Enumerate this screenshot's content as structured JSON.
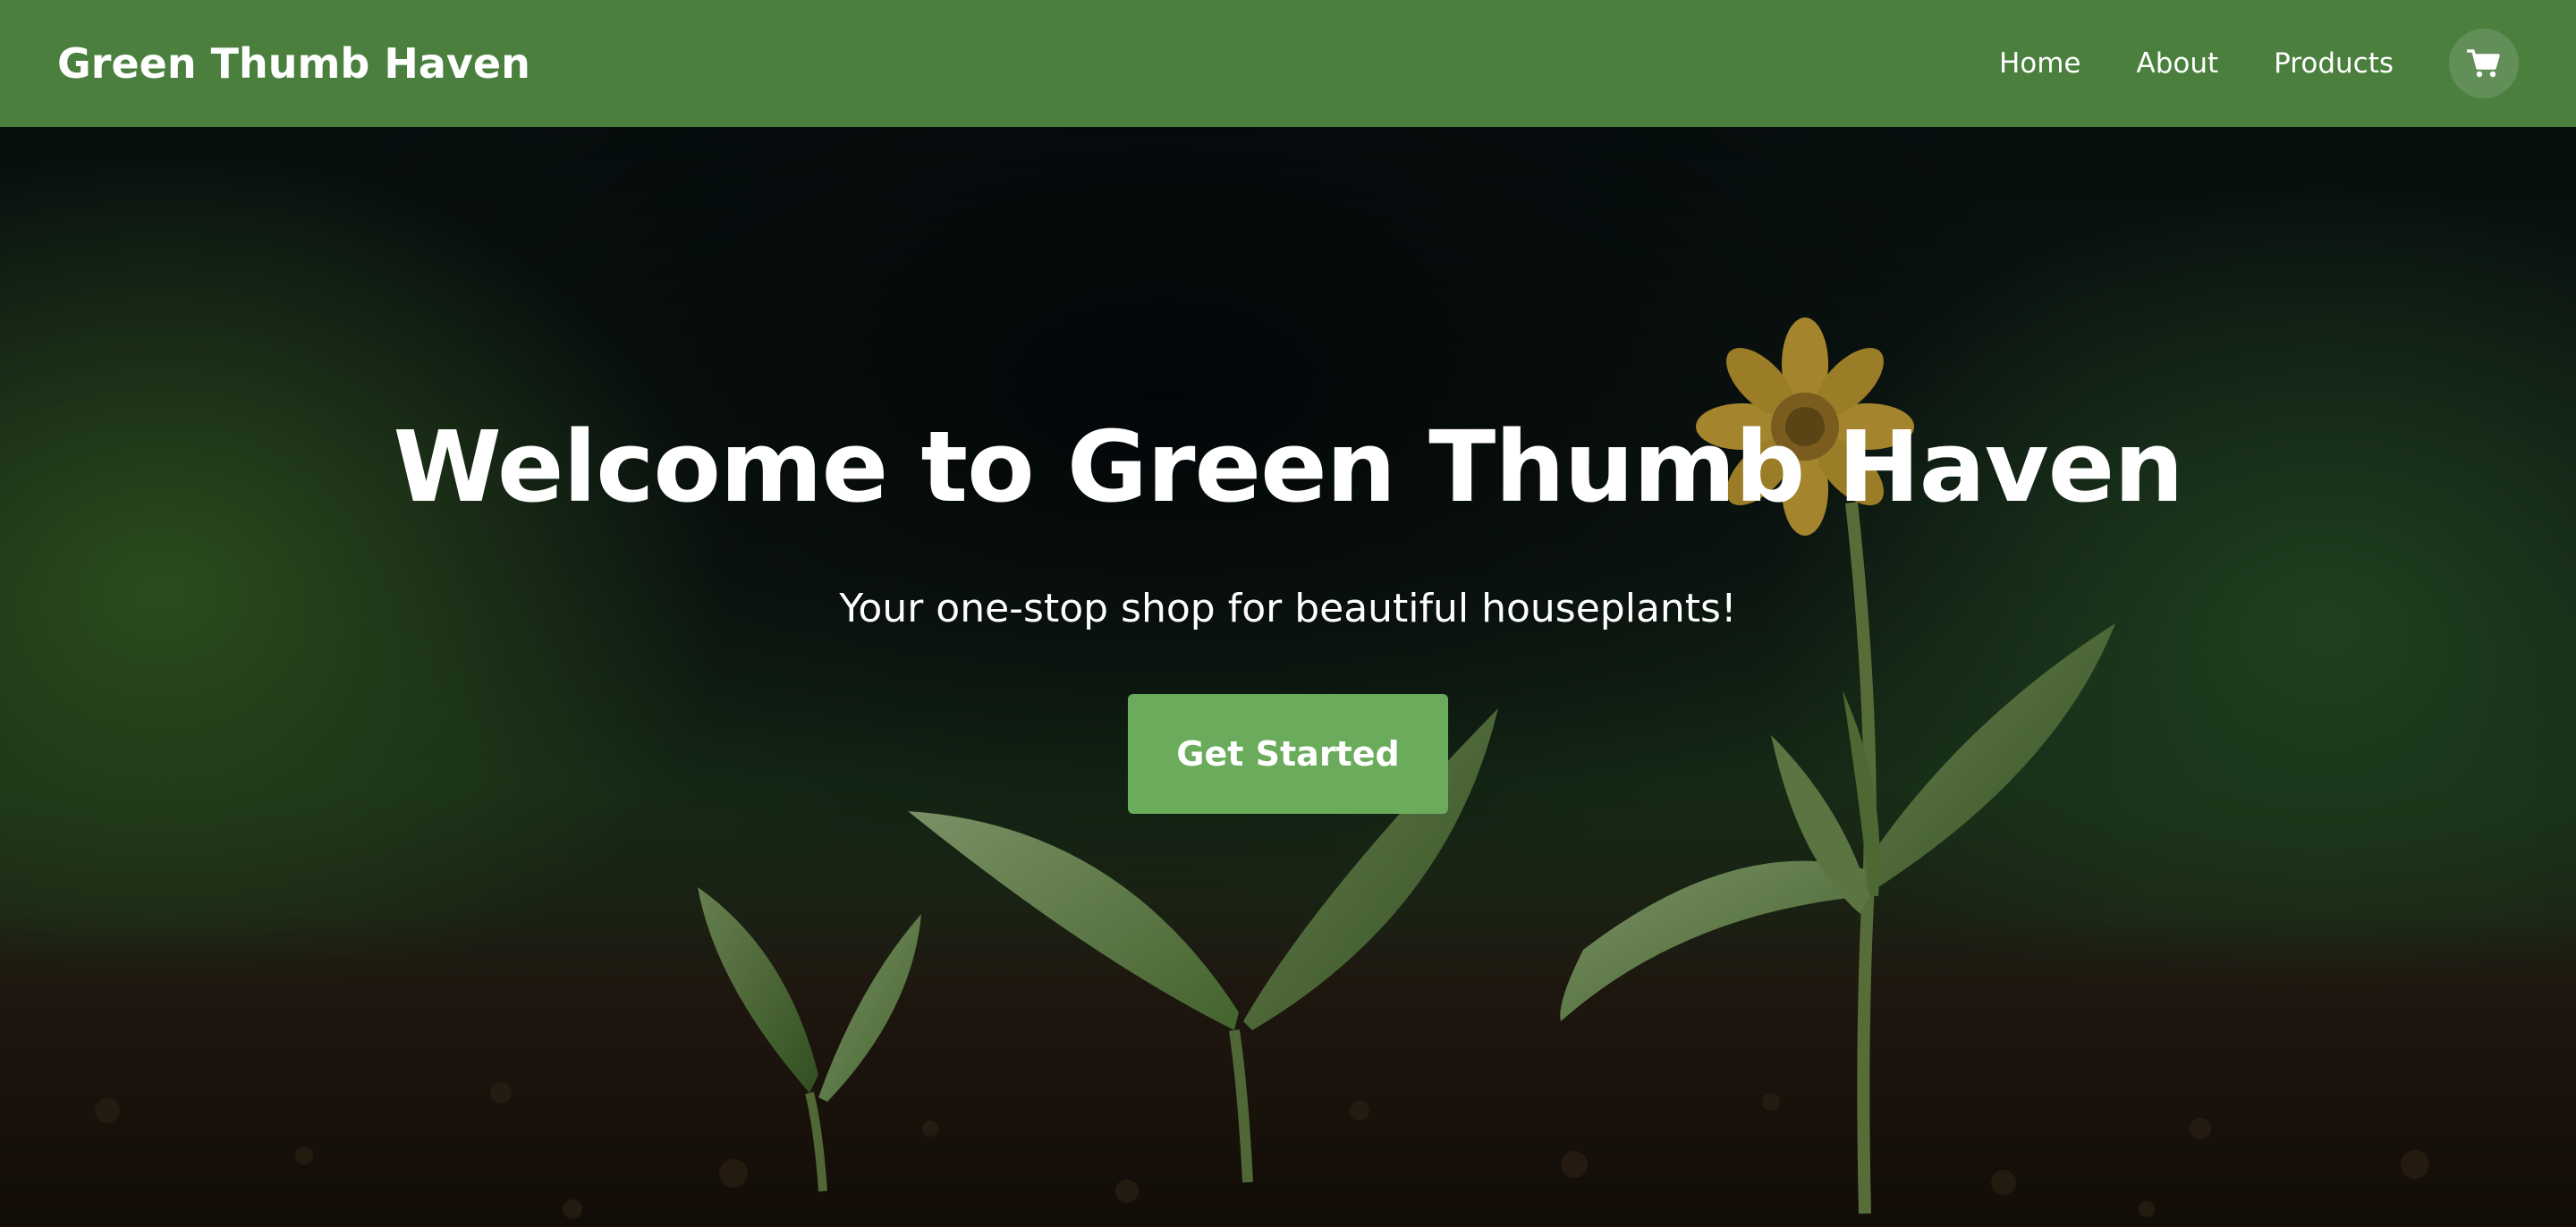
{
  "navbar": {
    "brand": "Green Thumb Haven",
    "links": [
      {
        "label": "Home"
      },
      {
        "label": "About"
      },
      {
        "label": "Products"
      }
    ],
    "cart_icon": "shopping-cart-icon",
    "background_color": "#4a7f3e"
  },
  "hero": {
    "title": "Welcome to Green Thumb Haven",
    "subtitle": "Your one-stop shop for beautiful houseplants!",
    "cta_label": "Get Started",
    "cta_color": "#6aab5c",
    "background_image": "seedlings-in-soil-with-yellow-flower"
  }
}
